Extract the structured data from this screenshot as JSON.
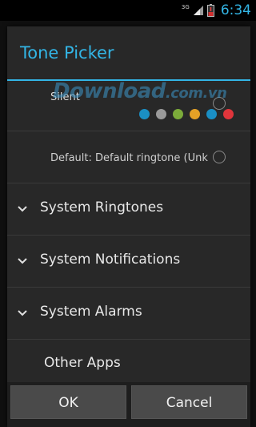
{
  "status_bar": {
    "network": "3G",
    "time": "6:34",
    "accent": "#33b5e5",
    "icons": [
      "signal-icon",
      "battery-icon"
    ]
  },
  "dialog": {
    "title": "Tone Picker",
    "items": {
      "silent": {
        "label": "Silent",
        "selected": false
      },
      "default": {
        "label": "Default: Default ringtone (Unknown)",
        "selected": false
      },
      "groups": [
        {
          "label": "System Ringtones",
          "icon": "chevron-down-icon"
        },
        {
          "label": "System Notifications",
          "icon": "chevron-down-icon"
        },
        {
          "label": "System Alarms",
          "icon": "chevron-down-icon"
        }
      ],
      "other": {
        "label": "Other Apps"
      }
    },
    "buttons": {
      "ok": "OK",
      "cancel": "Cancel"
    }
  },
  "watermark": {
    "text_main": "Download",
    "text_suffix": ".com.vn",
    "dot_colors": [
      "#1a8fc4",
      "#9a9a9a",
      "#7cab3a",
      "#e5a126",
      "#1a8fc4",
      "#e0353b"
    ]
  }
}
